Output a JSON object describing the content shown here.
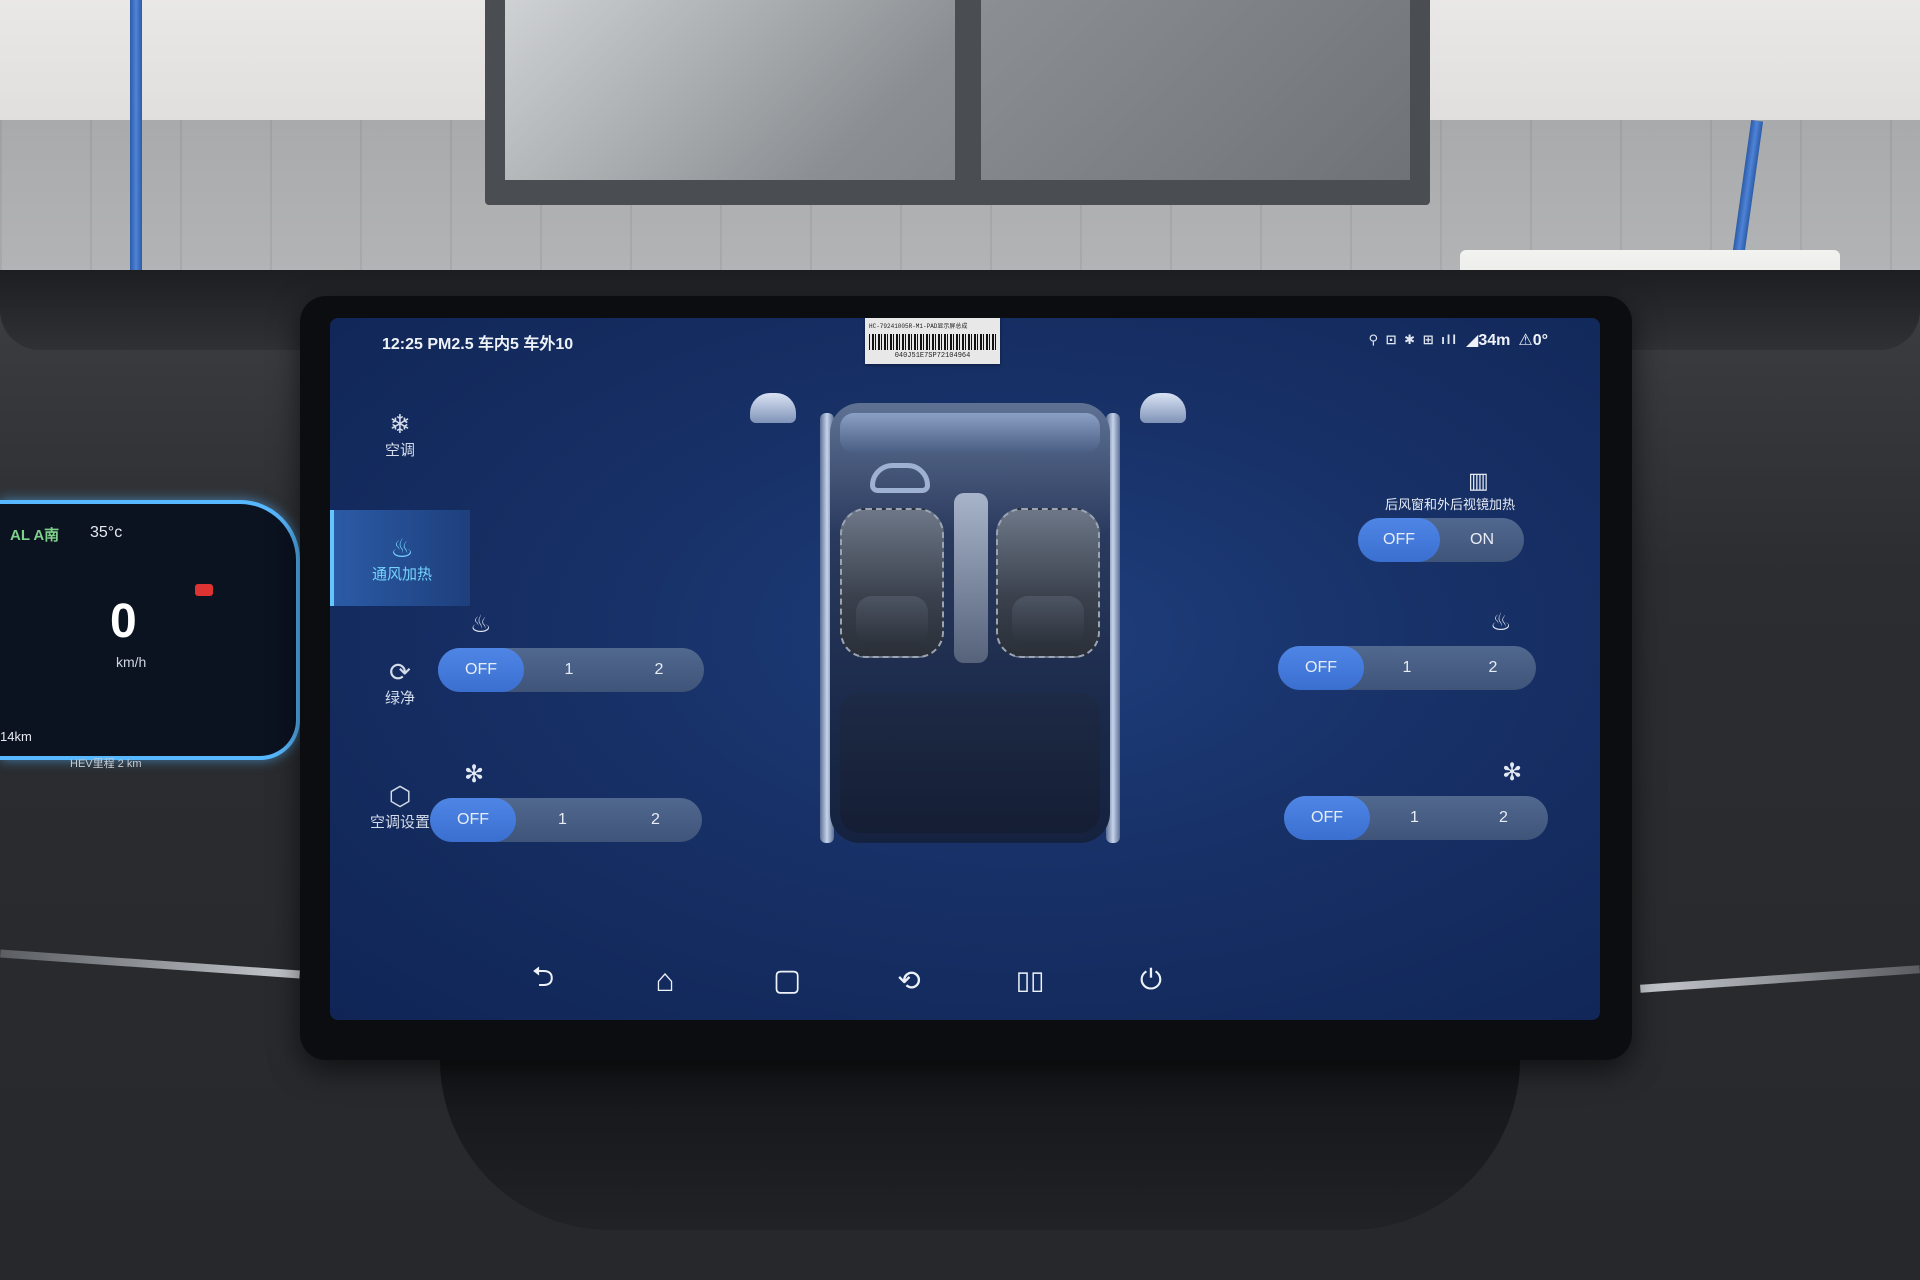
{
  "status_bar": {
    "left_text": "12:25 PM2.5 车内5 车外10",
    "right_icons": "⚲ ⊡ ✱ ⊞ ıll",
    "signal_text": "◢34m",
    "alert_text": "⚠0°"
  },
  "sticker": {
    "line1": "HC-79241005R-M1-PAD显示屏总成",
    "code": "040J51E7SP72104964"
  },
  "cluster": {
    "gear": "AL A南",
    "temp": "35°c",
    "speed": "0",
    "unit": "km/h",
    "range": "14km",
    "sub": "HEV里程 2 km"
  },
  "sidebar": {
    "items": [
      {
        "label": "空调",
        "icon": "snowflake-icon",
        "glyph": "❄"
      },
      {
        "label": "通风加热",
        "icon": "seat-heat-icon",
        "glyph": "♨"
      },
      {
        "label": "绿净",
        "icon": "leaf-icon",
        "glyph": "⟳"
      },
      {
        "label": "空调设置",
        "icon": "settings-hex-icon",
        "glyph": "⬡"
      }
    ],
    "active_index": 1
  },
  "controls": {
    "left_heat": {
      "options": [
        "OFF",
        "1",
        "2"
      ],
      "selected": "OFF"
    },
    "left_vent": {
      "options": [
        "OFF",
        "1",
        "2"
      ],
      "selected": "OFF"
    },
    "right_heat": {
      "options": [
        "OFF",
        "1",
        "2"
      ],
      "selected": "OFF"
    },
    "right_vent": {
      "options": [
        "OFF",
        "1",
        "2"
      ],
      "selected": "OFF"
    },
    "defrost": {
      "label": "后风窗和外后视镜加热",
      "options": [
        "OFF",
        "ON"
      ],
      "selected": "OFF"
    }
  },
  "nav": {
    "back": "⮌",
    "home": "⌂",
    "recent": "▢",
    "nav4": "⟲",
    "split": "▯▯",
    "power": "⏻"
  },
  "colors": {
    "accent": "#63c7ff",
    "selected": "#3a6fd0",
    "screen_bg": "#173066"
  }
}
